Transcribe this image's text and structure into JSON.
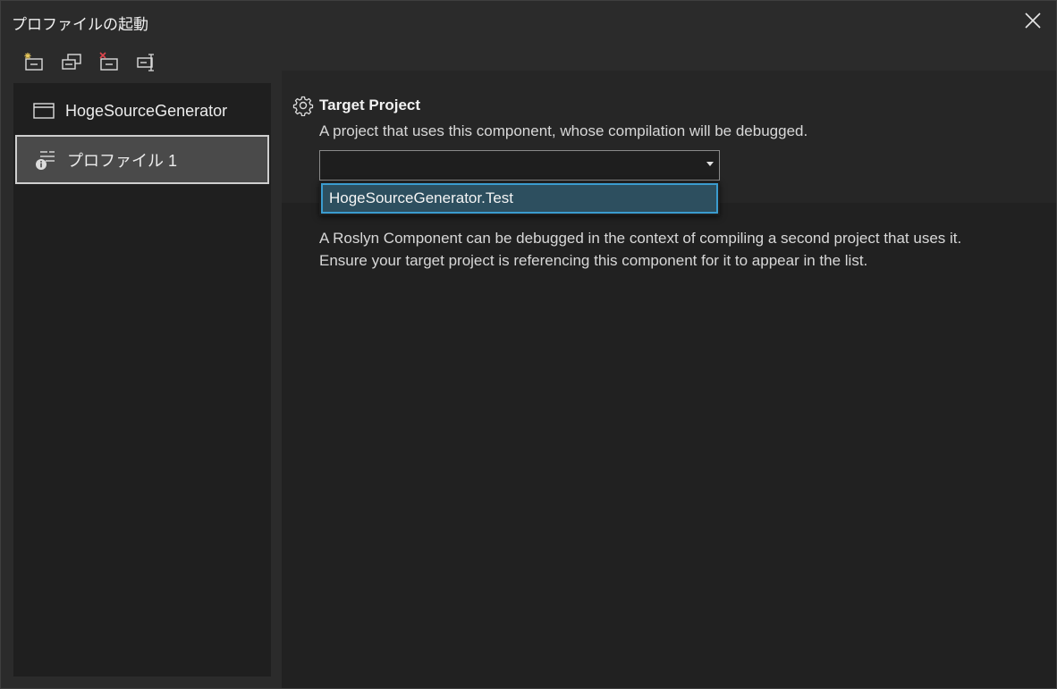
{
  "window": {
    "title": "プロファイルの起動"
  },
  "icons": {
    "close": "close-icon",
    "new_profile": "new-profile-icon",
    "duplicate_profile": "duplicate-profile-icon",
    "delete_profile": "delete-profile-icon",
    "rename_profile": "rename-profile-icon",
    "project": "window-icon",
    "profile": "roslyn-profile-icon",
    "settings": "gear-icon"
  },
  "colors": {
    "accent": "#3b9ccf",
    "selected_bg": "#4a4a4a",
    "dropdown_highlight": "#2d4f5f",
    "delete_mark": "#e0464e"
  },
  "profiles": [
    {
      "label": "HogeSourceGenerator",
      "selected": false
    },
    {
      "label": "プロファイル 1",
      "selected": true
    }
  ],
  "settings": {
    "target_project": {
      "label": "Target Project",
      "description": "A project that uses this component, whose compilation will be debugged.",
      "value": "",
      "options": [
        "HogeSourceGenerator.Test"
      ]
    },
    "help_text": "A Roslyn Component can be debugged in the context of compiling a second project that uses it. Ensure your target project is referencing this component for it to appear in the list."
  }
}
